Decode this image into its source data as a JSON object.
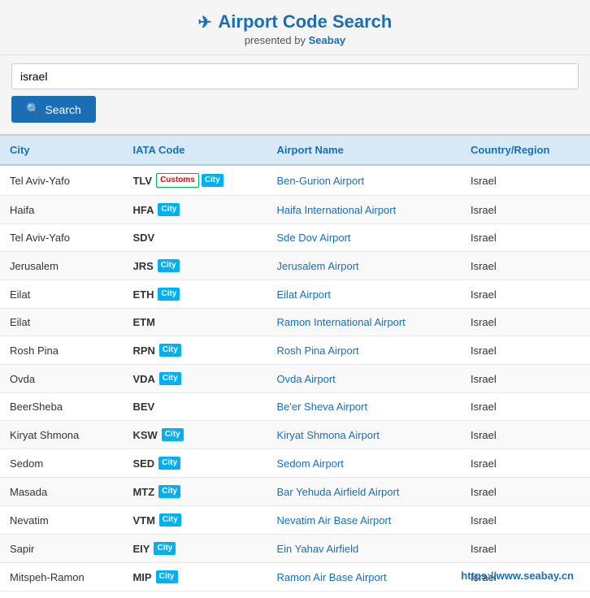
{
  "header": {
    "title": "Airport Code Search",
    "subtitle": "presented by",
    "brand": "Seabay"
  },
  "search": {
    "placeholder": "israel",
    "value": "israel",
    "button_label": "Search"
  },
  "table": {
    "columns": [
      "City",
      "IATA Code",
      "Airport Name",
      "Country/Region"
    ],
    "rows": [
      {
        "city": "Tel Aviv-Yafo",
        "iata": "TLV",
        "badges": [
          "Customs",
          "City"
        ],
        "airport": "Ben-Gurion Airport",
        "country": "Israel"
      },
      {
        "city": "Haifa",
        "iata": "HFA",
        "badges": [
          "City"
        ],
        "airport": "Haifa International Airport",
        "country": "Israel"
      },
      {
        "city": "Tel Aviv-Yafo",
        "iata": "SDV",
        "badges": [],
        "airport": "Sde Dov Airport",
        "country": "Israel"
      },
      {
        "city": "Jerusalem",
        "iata": "JRS",
        "badges": [
          "City"
        ],
        "airport": "Jerusalem Airport",
        "country": "Israel"
      },
      {
        "city": "Eilat",
        "iata": "ETH",
        "badges": [
          "City"
        ],
        "airport": "Eilat Airport",
        "country": "Israel"
      },
      {
        "city": "Eilat",
        "iata": "ETM",
        "badges": [],
        "airport": "Ramon International Airport",
        "country": "Israel"
      },
      {
        "city": "Rosh Pina",
        "iata": "RPN",
        "badges": [
          "City"
        ],
        "airport": "Rosh Pina Airport",
        "country": "Israel"
      },
      {
        "city": "Ovda",
        "iata": "VDA",
        "badges": [
          "City"
        ],
        "airport": "Ovda Airport",
        "country": "Israel"
      },
      {
        "city": "BeerSheba",
        "iata": "BEV",
        "badges": [],
        "airport": "Be'er Sheva Airport",
        "country": "Israel"
      },
      {
        "city": "Kiryat Shmona",
        "iata": "KSW",
        "badges": [
          "City"
        ],
        "airport": "Kiryat Shmona Airport",
        "country": "Israel"
      },
      {
        "city": "Sedom",
        "iata": "SED",
        "badges": [
          "City"
        ],
        "airport": "Sedom Airport",
        "country": "Israel"
      },
      {
        "city": "Masada",
        "iata": "MTZ",
        "badges": [
          "City"
        ],
        "airport": "Bar Yehuda Airfield Airport",
        "country": "Israel"
      },
      {
        "city": "Nevatim",
        "iata": "VTM",
        "badges": [
          "City"
        ],
        "airport": "Nevatim Air Base Airport",
        "country": "Israel"
      },
      {
        "city": "Sapir",
        "iata": "EIY",
        "badges": [
          "City"
        ],
        "airport": "Ein Yahav Airfield",
        "country": "Israel"
      },
      {
        "city": "Mitspeh-Ramon",
        "iata": "MIP",
        "badges": [
          "City"
        ],
        "airport": "Ramon Air Base Airport",
        "country": "Israel"
      }
    ]
  },
  "watermark": "https://www.seabay.cn"
}
